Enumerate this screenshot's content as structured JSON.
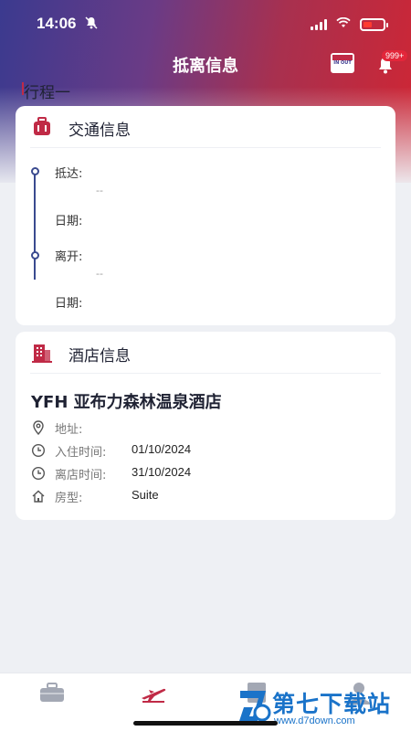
{
  "status_bar": {
    "time": "14:06"
  },
  "header": {
    "title": "抵离信息",
    "checkin_icon_text": "IN OUT",
    "notification_badge": "999+"
  },
  "trip": {
    "title": "行程一"
  },
  "transport": {
    "section_title": "交通信息",
    "arrive_label": "抵达:",
    "arrive_value": "--",
    "arrive_date_label": "日期:",
    "depart_label": "离开:",
    "depart_value": "--",
    "depart_date_label": "日期:"
  },
  "hotel": {
    "section_title": "酒店信息",
    "name": "YFH 亚布力森林温泉酒店",
    "address_label": "地址:",
    "address_value": "",
    "checkin_label": "入住时间:",
    "checkin_value": "01/10/2024",
    "checkout_label": "离店时间:",
    "checkout_value": "31/10/2024",
    "room_label": "房型:",
    "room_value": "Suite"
  },
  "tabs": [
    {
      "icon": "briefcase-icon"
    },
    {
      "icon": "airplane-icon",
      "active": true
    },
    {
      "icon": "document-icon"
    },
    {
      "icon": "profile-icon"
    }
  ],
  "watermark": {
    "text": "第七下载站",
    "url": "www.d7down.com"
  },
  "colors": {
    "accent_red": "#c02a46",
    "accent_blue": "#3a4a8f",
    "header_gradient_start": "#3b3a8f",
    "header_gradient_end": "#cf2634"
  }
}
